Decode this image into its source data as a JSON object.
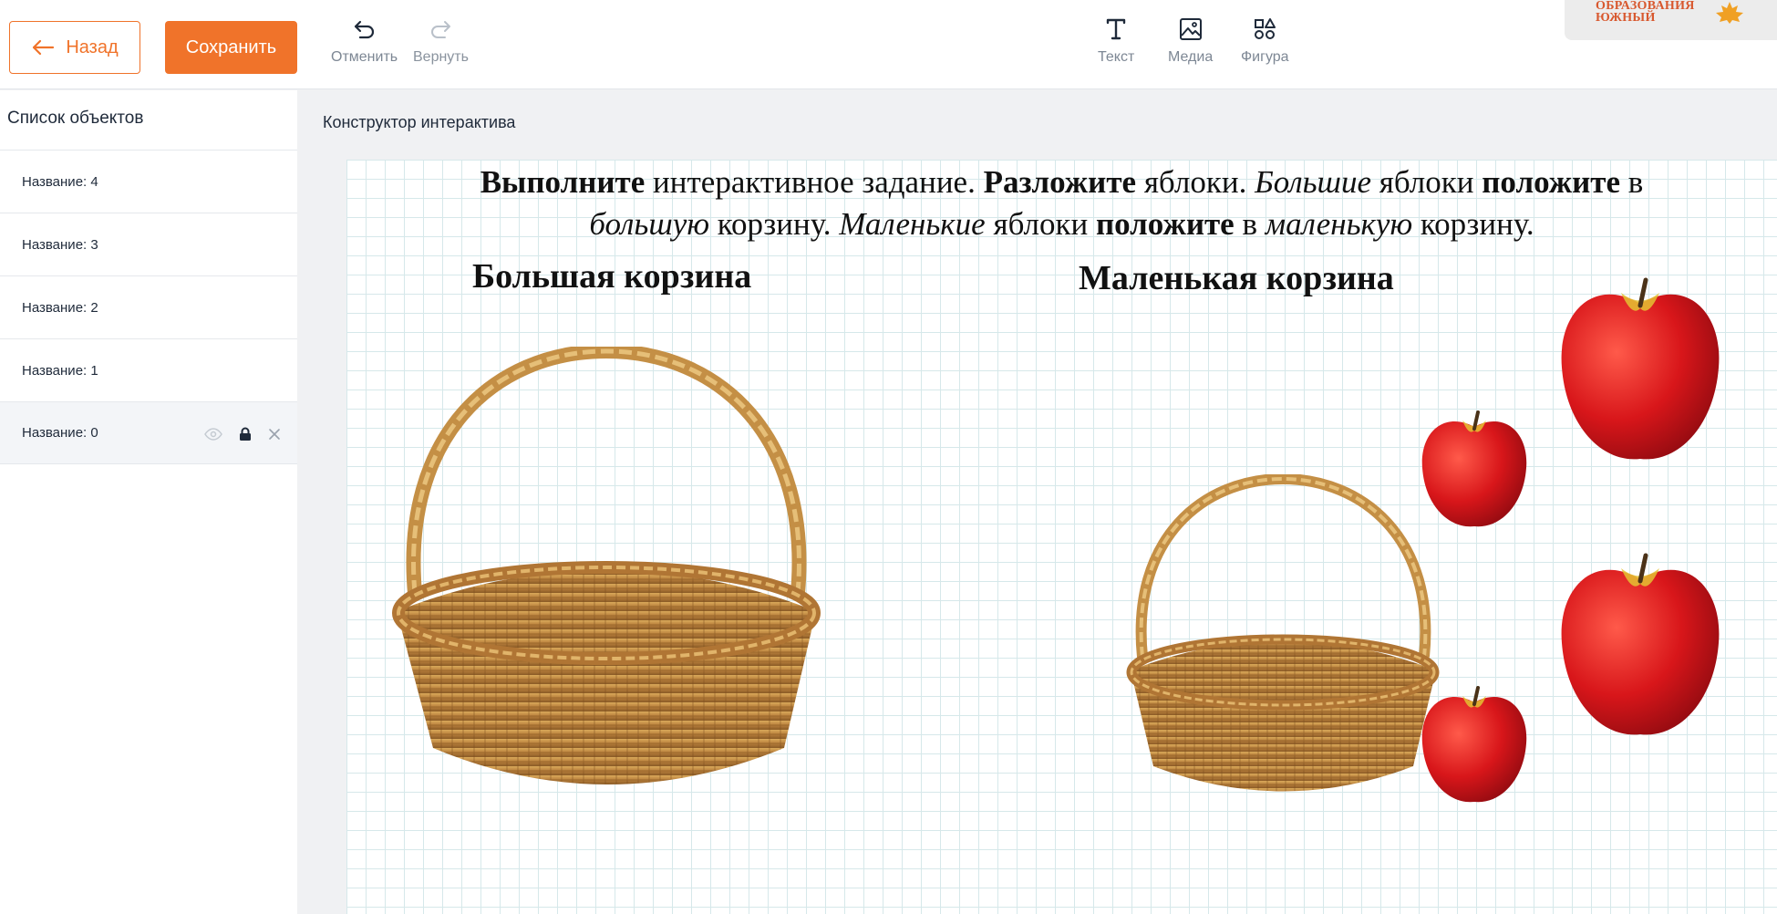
{
  "toolbar": {
    "back_label": "Назад",
    "save_label": "Сохранить",
    "undo_label": "Отменить",
    "redo_label": "Вернуть",
    "text_label": "Текст",
    "media_label": "Медиа",
    "shape_label": "Фигура",
    "logo_line1": "ОБРАЗОВАНИЯ",
    "logo_line2": "ЮЖНЫЙ",
    "accent_color": "#f0732a"
  },
  "sidebar": {
    "title": "Список объектов",
    "items": [
      {
        "label": "Название: 4"
      },
      {
        "label": "Название: 3"
      },
      {
        "label": "Название: 2"
      },
      {
        "label": "Название: 1"
      },
      {
        "label": "Название: 0",
        "selected": true
      }
    ]
  },
  "main": {
    "title": "Конструктор интерактива",
    "instruction": {
      "w1": "Выполните",
      "w2": " интерактивное задание. ",
      "w3": "Разложите",
      "w4": " яблоки. ",
      "w5": "Большие",
      "w6": " яблоки ",
      "w7": "положите",
      "w8": " в ",
      "w9": "большую",
      "w10": " корзину. ",
      "w11": "Маленькие",
      "w12": " яблоки ",
      "w13": "положите",
      "w14": " в ",
      "w15": "маленькую",
      "w16": " корзину."
    },
    "big_basket_label": "Большая корзина",
    "small_basket_label": "Маленькая корзина"
  }
}
